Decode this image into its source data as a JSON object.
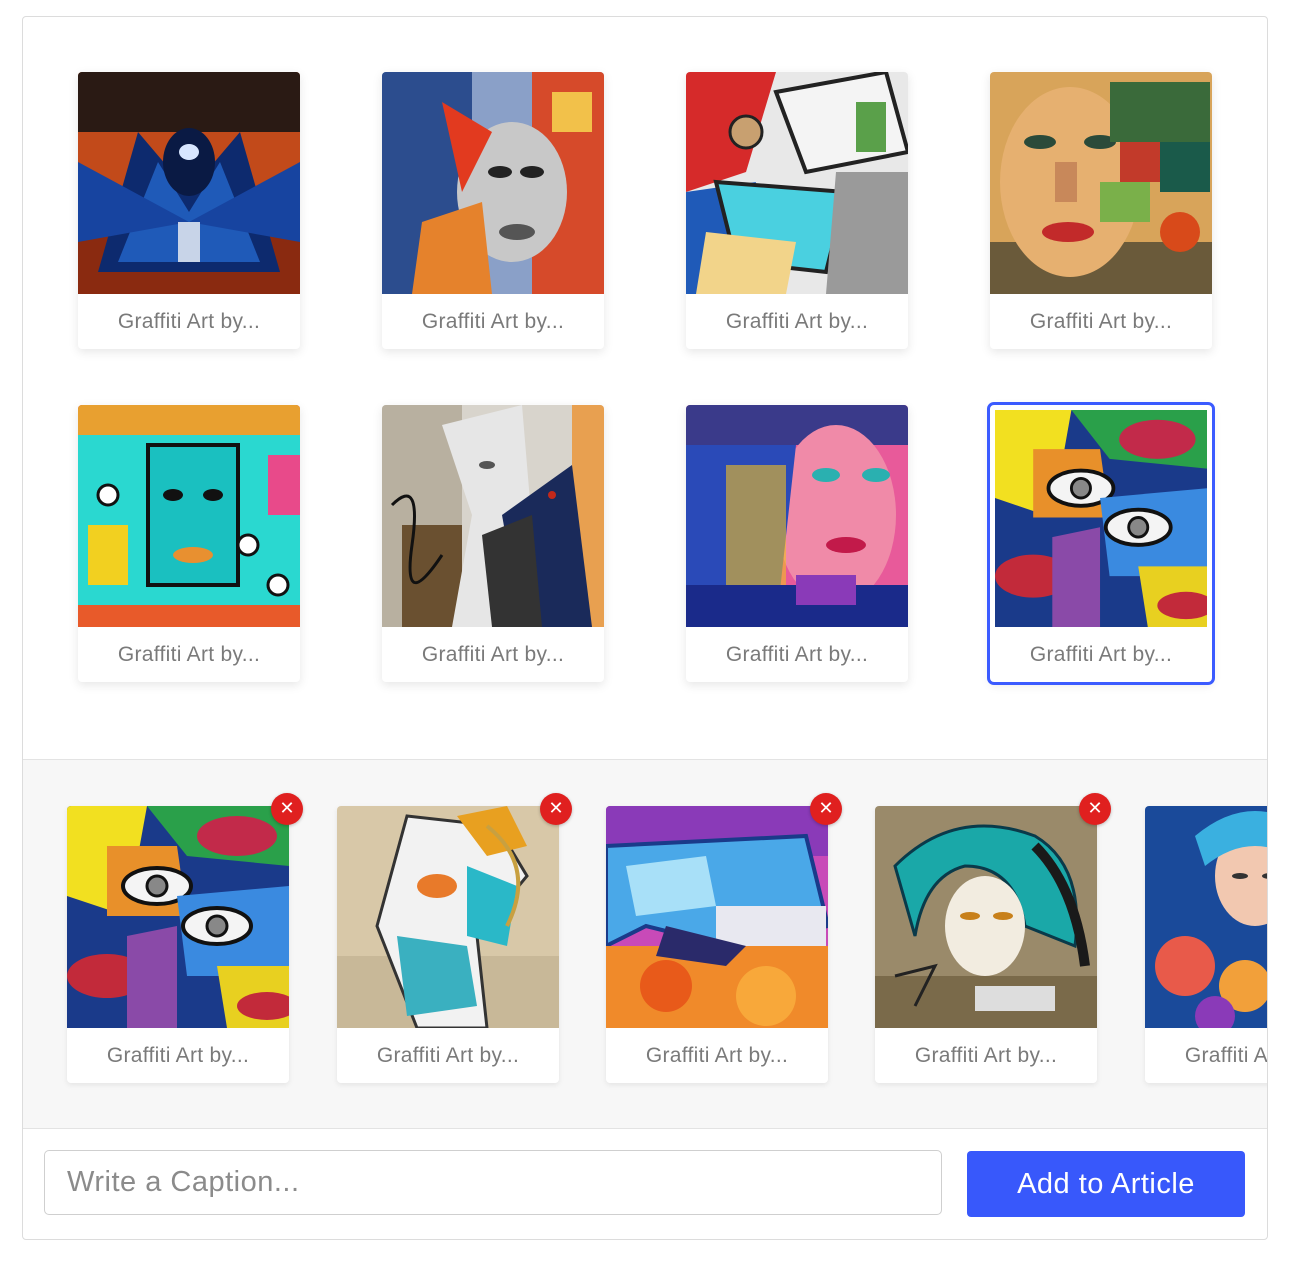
{
  "gallery": {
    "items": [
      {
        "caption": "Graffiti Art by...",
        "art": "bird",
        "selected": false
      },
      {
        "caption": "Graffiti Art by...",
        "art": "woman-collage",
        "selected": false
      },
      {
        "caption": "Graffiti Art by...",
        "art": "letters",
        "selected": false
      },
      {
        "caption": "Graffiti Art by...",
        "art": "face-mosaic",
        "selected": false
      },
      {
        "caption": "Graffiti Art by...",
        "art": "cyan-faces",
        "selected": false
      },
      {
        "caption": "Graffiti Art by...",
        "art": "profile-mural",
        "selected": false
      },
      {
        "caption": "Graffiti Art by...",
        "art": "pink-face",
        "selected": false
      },
      {
        "caption": "Graffiti Art by...",
        "art": "eyes-lips",
        "selected": true
      }
    ]
  },
  "tray": {
    "items": [
      {
        "caption": "Graffiti Art by...",
        "art": "eyes-lips"
      },
      {
        "caption": "Graffiti Art by...",
        "art": "mask-figure"
      },
      {
        "caption": "Graffiti Art by...",
        "art": "blue-letters"
      },
      {
        "caption": "Graffiti Art by...",
        "art": "teal-hair-girl"
      },
      {
        "caption": "Graffiti Art by...",
        "art": "flower-woman"
      }
    ],
    "remove_symbol": "✕"
  },
  "footer": {
    "caption_placeholder": "Write a Caption...",
    "caption_value": "",
    "add_button_label": "Add to Article"
  },
  "colors": {
    "accent": "#3858fb",
    "selected_outline": "#3b5bff",
    "remove_badge": "#e0201f"
  }
}
